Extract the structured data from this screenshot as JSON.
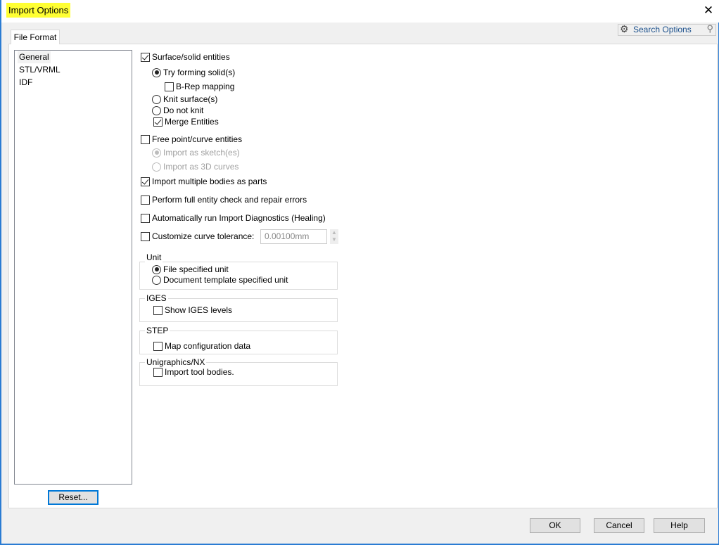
{
  "window": {
    "title": "Import Options",
    "close_icon": "close-icon"
  },
  "tabs": [
    {
      "label": "File Format",
      "active": true
    }
  ],
  "search": {
    "placeholder": "Search Options",
    "icon": "gear-icon",
    "search_icon": "magnifier-icon"
  },
  "sidebar": {
    "items": [
      {
        "label": "General",
        "selected": true
      },
      {
        "label": "STL/VRML"
      },
      {
        "label": "IDF"
      }
    ],
    "reset_label": "Reset..."
  },
  "options": {
    "surface_solid": {
      "label": "Surface/solid entities",
      "checked": true
    },
    "try_forming": {
      "label": "Try forming solid(s)",
      "selected": true
    },
    "brep": {
      "label": "B-Rep mapping",
      "checked": false
    },
    "knit": {
      "label": "Knit surface(s)",
      "selected": false
    },
    "no_knit": {
      "label": "Do not knit",
      "selected": false
    },
    "merge": {
      "label": "Merge Entities",
      "checked": true
    },
    "free_point": {
      "label": "Free point/curve entities",
      "checked": false
    },
    "as_sketch": {
      "label": "Import as sketch(es)",
      "selected": true,
      "disabled": true
    },
    "as_3d": {
      "label": "Import as 3D curves",
      "selected": false,
      "disabled": true
    },
    "multi_bodies": {
      "label": "Import multiple bodies as parts",
      "checked": true
    },
    "full_check": {
      "label": "Perform full entity check and repair errors",
      "checked": false
    },
    "diagnostics": {
      "label": "Automatically run Import Diagnostics (Healing)",
      "checked": false
    },
    "tolerance": {
      "label": "Customize curve tolerance:",
      "checked": false,
      "value": "0.00100mm"
    }
  },
  "groups": {
    "unit": {
      "title": "Unit",
      "file_unit": "File specified unit",
      "doc_unit": "Document template specified unit",
      "selected": "file_unit"
    },
    "iges": {
      "title": "IGES",
      "show_levels": "Show IGES levels",
      "checked": false
    },
    "step": {
      "title": "STEP",
      "map_config": "Map configuration data",
      "checked": false
    },
    "nx": {
      "title": "Unigraphics/NX",
      "tool_bodies": "Import tool bodies.",
      "checked": false
    }
  },
  "footer": {
    "ok": "OK",
    "cancel": "Cancel",
    "help": "Help"
  },
  "colors": {
    "accent": "#0078d7",
    "title_highlight": "#ffff33"
  }
}
